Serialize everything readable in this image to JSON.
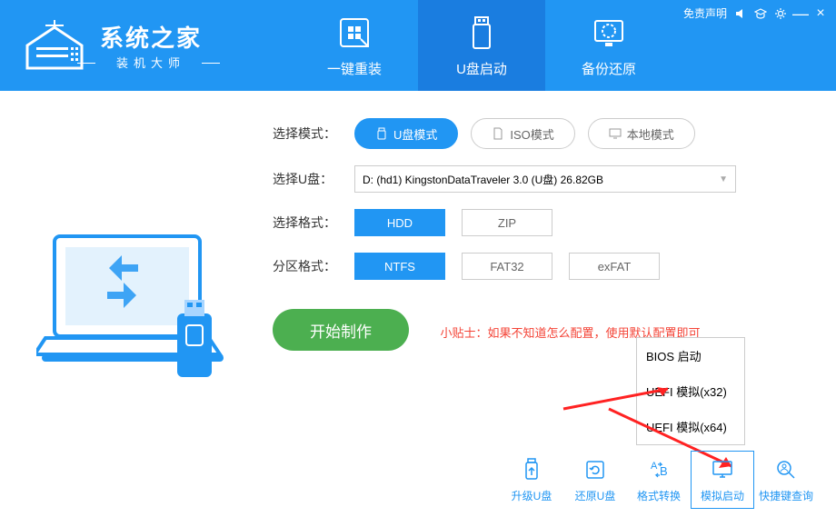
{
  "titlebar": {
    "disclaimer": "免责声明"
  },
  "logo": {
    "title": "系统之家",
    "subtitle": "装机大师"
  },
  "tabs": [
    {
      "label": "一键重装"
    },
    {
      "label": "U盘启动"
    },
    {
      "label": "备份还原"
    }
  ],
  "rows": {
    "mode_label": "选择模式：",
    "modes": [
      {
        "label": "U盘模式"
      },
      {
        "label": "ISO模式"
      },
      {
        "label": "本地模式"
      }
    ],
    "udisk_label": "选择U盘：",
    "udisk_value": "D: (hd1) KingstonDataTraveler 3.0 (U盘) 26.82GB",
    "format_label": "选择格式：",
    "formats": [
      "HDD",
      "ZIP"
    ],
    "partition_label": "分区格式：",
    "partitions": [
      "NTFS",
      "FAT32",
      "exFAT"
    ]
  },
  "start_button": "开始制作",
  "tip_prefix": "小贴士：",
  "tip_text": "如果不知道怎么配置，使用默认配置即可",
  "popup": [
    "BIOS 启动",
    "UEFI 模拟(x32)",
    "UEFI 模拟(x64)"
  ],
  "tools": [
    {
      "label": "升级U盘"
    },
    {
      "label": "还原U盘"
    },
    {
      "label": "格式转换"
    },
    {
      "label": "模拟启动"
    },
    {
      "label": "快捷键查询"
    }
  ]
}
